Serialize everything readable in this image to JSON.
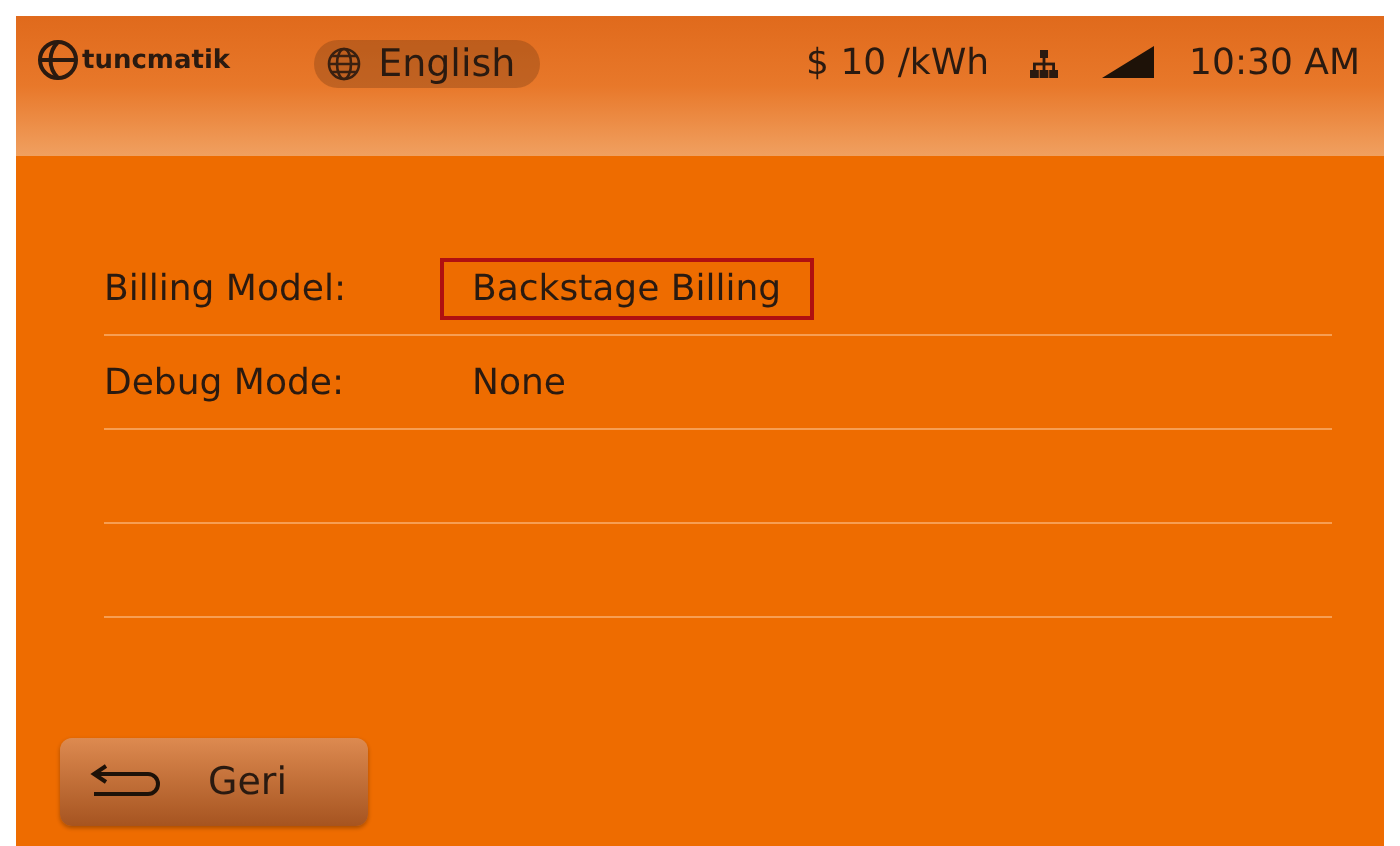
{
  "header": {
    "brand": "tuncmatik",
    "language": "English",
    "price": "$ 10 /kWh",
    "time": "10:30 AM"
  },
  "settings": [
    {
      "label": "Billing Model:",
      "value": "Backstage Billing",
      "selected": true
    },
    {
      "label": "Debug Mode:",
      "value": "None",
      "selected": false
    }
  ],
  "back_button": {
    "label": "Geri"
  }
}
